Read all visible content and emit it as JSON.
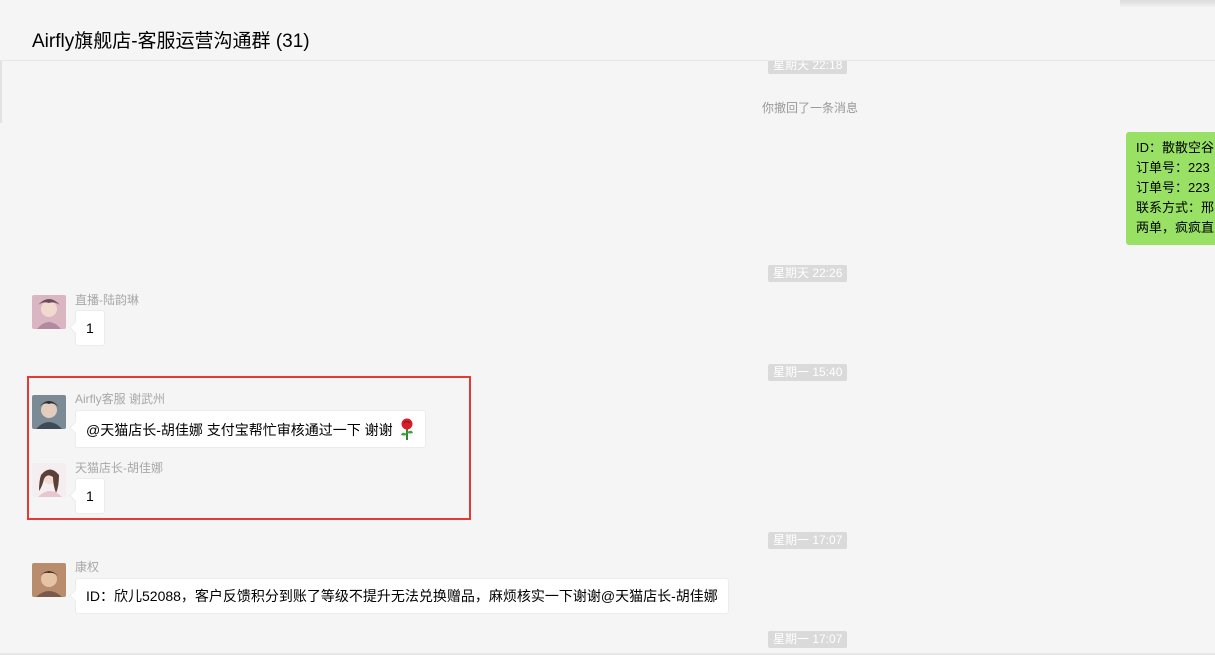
{
  "header": {
    "title": "Airfly旗舰店-客服运营沟通群 (31)"
  },
  "messages": {
    "time_1": "星期天 22:18",
    "recall_notice": "你撤回了一条消息",
    "own_message_lines": [
      "ID：散散空谷",
      "订单号：223",
      "订单号：223",
      "联系方式：邢",
      "两单，疯疯直"
    ],
    "time_2": "星期天 22:26",
    "msg1": {
      "sender": "直播-陆韵琳",
      "text": "1"
    },
    "time_3": "星期一 15:40",
    "msg2": {
      "sender": "Airfly客服 谢武州",
      "text": "@天猫店长-胡佳娜  支付宝帮忙审核通过一下 谢谢"
    },
    "msg3": {
      "sender": "天猫店长-胡佳娜",
      "text": "1"
    },
    "time_4": "星期一 17:07",
    "msg4": {
      "sender": "康权",
      "text": "ID：欣儿52088，客户反馈积分到账了等级不提升无法兑换赠品，麻烦核实一下谢谢@天猫店长-胡佳娜"
    },
    "time_5": "星期一 17:07"
  },
  "icons": {
    "emoji": "rose-emoji-icon"
  },
  "colors": {
    "highlight": "#e53935",
    "own_bubble": "#98e165",
    "time_badge": "#dadada"
  }
}
